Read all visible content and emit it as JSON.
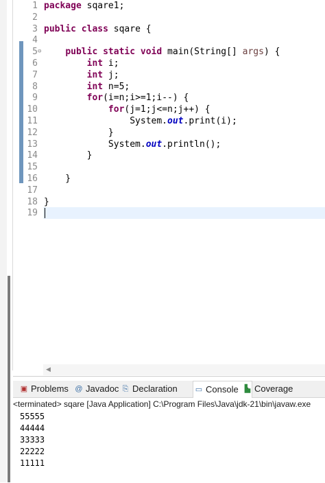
{
  "editor": {
    "lines": [
      {
        "n": "1",
        "fold": "",
        "html": "<span class=\"kw\">package</span> sqare1;"
      },
      {
        "n": "2",
        "fold": "",
        "html": ""
      },
      {
        "n": "3",
        "fold": "",
        "html": "<span class=\"kw\">public</span> <span class=\"kw\">class</span> sqare {"
      },
      {
        "n": "4",
        "fold": "",
        "html": ""
      },
      {
        "n": "5",
        "fold": "⊖",
        "html": "    <span class=\"kw\">public</span> <span class=\"kw\">static</span> <span class=\"kw\">void</span> main(String[] <span class=\"par\">args</span>) {"
      },
      {
        "n": "6",
        "fold": "",
        "html": "        <span class=\"kw\">int</span> i;"
      },
      {
        "n": "7",
        "fold": "",
        "html": "        <span class=\"kw\">int</span> j;"
      },
      {
        "n": "8",
        "fold": "",
        "html": "        <span class=\"kw\">int</span> n=5;"
      },
      {
        "n": "9",
        "fold": "",
        "html": "        <span class=\"kw\">for</span>(i=n;i&gt;=1;i--) {"
      },
      {
        "n": "10",
        "fold": "",
        "html": "            <span class=\"kw\">for</span>(j=1;j&lt;=n;j++) {"
      },
      {
        "n": "11",
        "fold": "",
        "html": "                System.<span class=\"fld\">out</span>.print(i);"
      },
      {
        "n": "12",
        "fold": "",
        "html": "            }"
      },
      {
        "n": "13",
        "fold": "",
        "html": "            System.<span class=\"fld\">out</span>.println();"
      },
      {
        "n": "14",
        "fold": "",
        "html": "        }"
      },
      {
        "n": "15",
        "fold": "",
        "html": ""
      },
      {
        "n": "16",
        "fold": "",
        "html": "    }"
      },
      {
        "n": "17",
        "fold": "",
        "html": ""
      },
      {
        "n": "18",
        "fold": "",
        "html": "}"
      },
      {
        "n": "19",
        "fold": "",
        "html": ""
      }
    ]
  },
  "views": {
    "tabs": [
      {
        "label": "Problems",
        "icon": "problems-icon",
        "glyph": "▣",
        "color": "#b03030",
        "active": false
      },
      {
        "label": "Javadoc",
        "icon": "javadoc-icon",
        "glyph": "@",
        "color": "#3a6ea5",
        "active": false
      },
      {
        "label": "Declaration",
        "icon": "declaration-icon",
        "glyph": "⎘",
        "color": "#3a6ea5",
        "active": false
      },
      {
        "label": "Console",
        "icon": "console-icon",
        "glyph": "▭",
        "color": "#3a6ea5",
        "active": true
      },
      {
        "label": "Coverage",
        "icon": "coverage-icon",
        "glyph": "▙",
        "color": "#2e8b3e",
        "active": false
      }
    ],
    "close_glyph": "×",
    "status": "<terminated> sqare [Java Application] C:\\Program Files\\Java\\jdk-21\\bin\\javaw.exe",
    "output": [
      "55555",
      "44444",
      "33333",
      "22222",
      "11111"
    ]
  },
  "scroll": {
    "left_arrow": "◀"
  }
}
